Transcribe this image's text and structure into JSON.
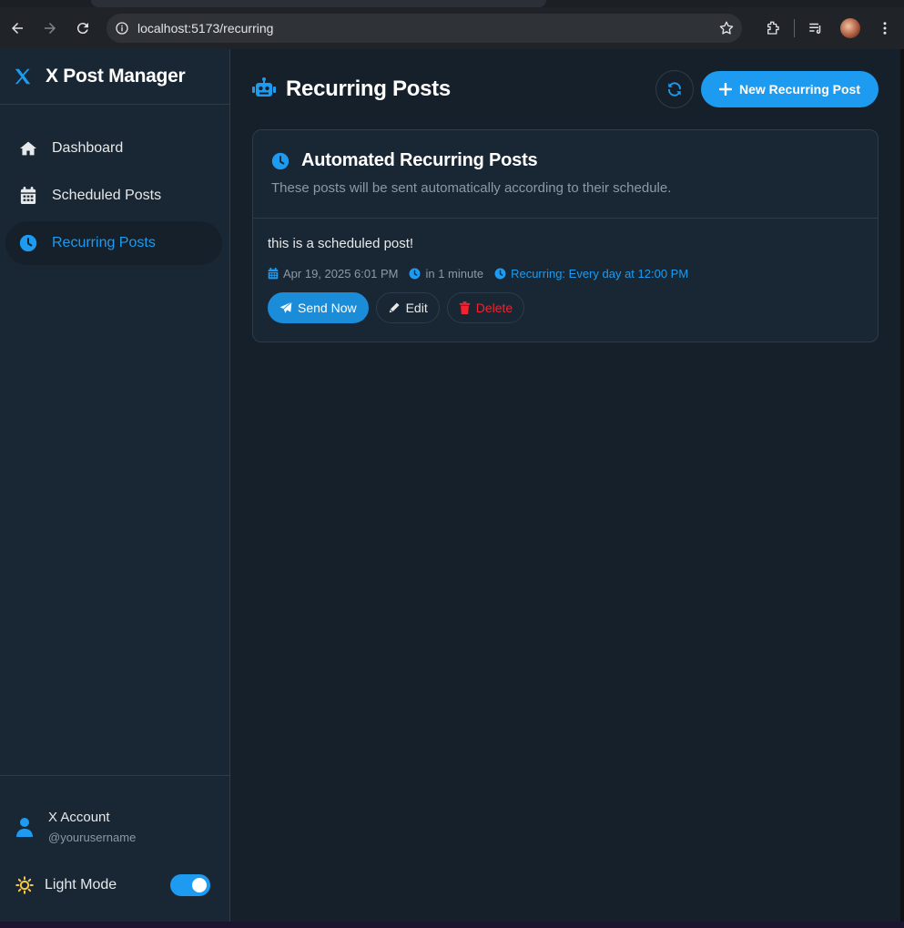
{
  "browser": {
    "url": "localhost:5173/recurring"
  },
  "sidebar": {
    "brand": "X Post Manager",
    "items": [
      {
        "label": "Dashboard",
        "icon": "home-icon"
      },
      {
        "label": "Scheduled Posts",
        "icon": "calendar-icon"
      },
      {
        "label": "Recurring Posts",
        "icon": "clock-icon",
        "active": true
      }
    ],
    "account": {
      "name": "X Account",
      "handle": "@yourusername"
    },
    "mode": {
      "label": "Light Mode",
      "toggle_on": true
    }
  },
  "main": {
    "title": "Recurring Posts",
    "new_button": "New Recurring Post",
    "card": {
      "title": "Automated Recurring Posts",
      "subtitle": "These posts will be sent automatically according to their schedule.",
      "posts": [
        {
          "text": "this is a scheduled post!",
          "date": "Apr 19, 2025 6:01 PM",
          "relative": "in 1 minute",
          "recurrence": "Recurring: Every day at 12:00 PM",
          "send_label": "Send Now",
          "edit_label": "Edit",
          "delete_label": "Delete"
        }
      ]
    }
  },
  "colors": {
    "accent": "#1d9bf0",
    "background": "#15202b",
    "sidebar": "#192734",
    "danger": "#f4212e"
  }
}
